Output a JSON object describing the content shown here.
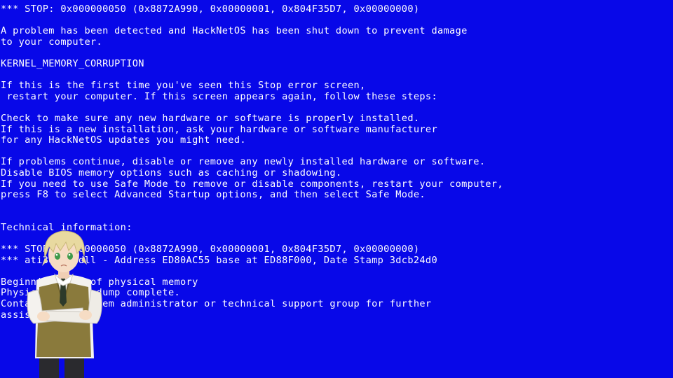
{
  "bsod": {
    "lines": [
      "*** STOP: 0x000000050 (0x8872A990, 0x00000001, 0x804F35D7, 0x00000000)",
      "",
      "A problem has been detected and HackNetOS has been shut down to prevent damage",
      "to your computer.",
      "",
      "KERNEL_MEMORY_CORRUPTION",
      "",
      "If this is the first time you've seen this Stop error screen,",
      " restart your computer. If this screen appears again, follow these steps:",
      "",
      "Check to make sure any new hardware or software is properly installed.",
      "If this is a new installation, ask your hardware or software manufacturer",
      "for any HackNetOS updates you might need.",
      "",
      "If problems continue, disable or remove any newly installed hardware or software.",
      "Disable BIOS memory options such as caching or shadowing.",
      "If you need to use Safe Mode to remove or disable components, restart your computer,",
      "press F8 to select Advanced Startup options, and then select Safe Mode.",
      "",
      "",
      "Technical information:",
      "",
      "*** STOP: 0x000000050 (0x8872A990, 0x00000001, 0x804F35D7, 0x00000000)",
      "*** ati3duag.dll - Address ED80AC55 base at ED88F000, Date Stamp 3dcb24d0",
      "",
      "Beginning dump of physical memory",
      "Physical memory dump complete.",
      "Contact your system administrator or technical support group for further",
      "assistance."
    ]
  },
  "character": {
    "icon": "anime-character-portrait",
    "colors": {
      "hair": "#e8d9a0",
      "vest": "#8a7a3c",
      "shirt": "#f4f2ee",
      "tie": "#2d3a2a",
      "pants": "#2a2a2e",
      "eyes": "#3f9a4a",
      "skin": "#f6dcc4"
    }
  },
  "colors": {
    "background": "#0808e8",
    "text": "#ffffff"
  }
}
